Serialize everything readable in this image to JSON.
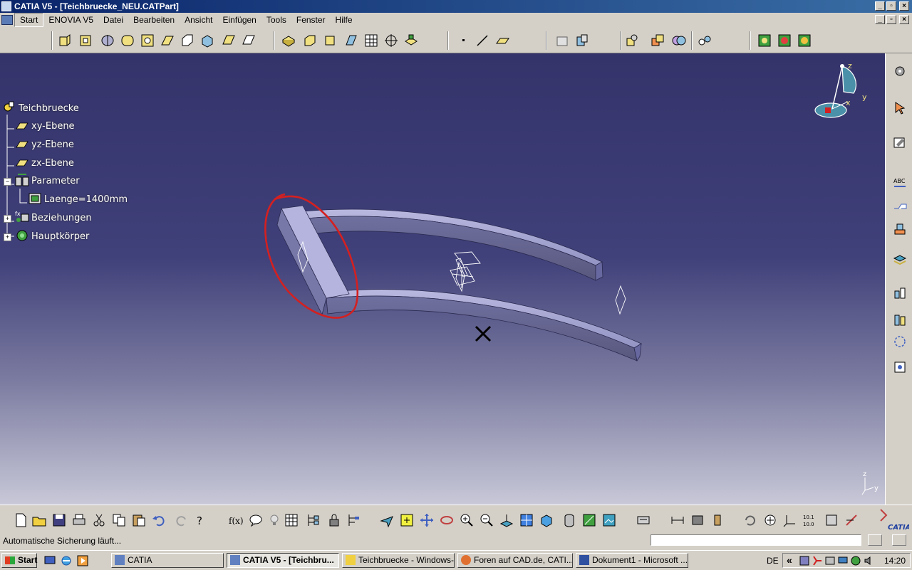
{
  "window": {
    "title": "CATIA V5 - [Teichbruecke_NEU.CATPart]",
    "buttons": [
      "_",
      "▫",
      "×"
    ]
  },
  "menu": {
    "items": [
      "Start",
      "ENOVIA V5",
      "Datei",
      "Bearbeiten",
      "Ansicht",
      "Einfügen",
      "Tools",
      "Fenster",
      "Hilfe"
    ]
  },
  "tree": {
    "root": "Teichbruecke",
    "planes": [
      "xy-Ebene",
      "yz-Ebene",
      "zx-Ebene"
    ],
    "parameters": "Parameter",
    "parameter_item": "Laenge=1400mm",
    "relations": "Beziehungen",
    "body": "Hauptkörper"
  },
  "compass": {
    "z": "z",
    "y": "y",
    "x": "x"
  },
  "axis_indicator": {
    "z": "z",
    "y": "y"
  },
  "status": {
    "message": "Automatische Sicherung läuft...",
    "command_value": ""
  },
  "taskbar": {
    "start": "Start",
    "tasks": [
      "CATIA",
      "CATIA V5 - [Teichbru...",
      "Teichbruecke - Windows-...",
      "Foren auf CAD.de, CATI...",
      "Dokument1 - Microsoft ..."
    ],
    "lang": "DE",
    "clock": "14:20",
    "tray_chevron": "«"
  },
  "brand": {
    "logo_text": "CATIA"
  },
  "colors": {
    "viewport_top": "#34336a",
    "viewport_bottom": "#c8c8d8",
    "highlight_circle": "#d42020",
    "title_bar": "#0a246a",
    "part_face": "#9c9ccc"
  }
}
